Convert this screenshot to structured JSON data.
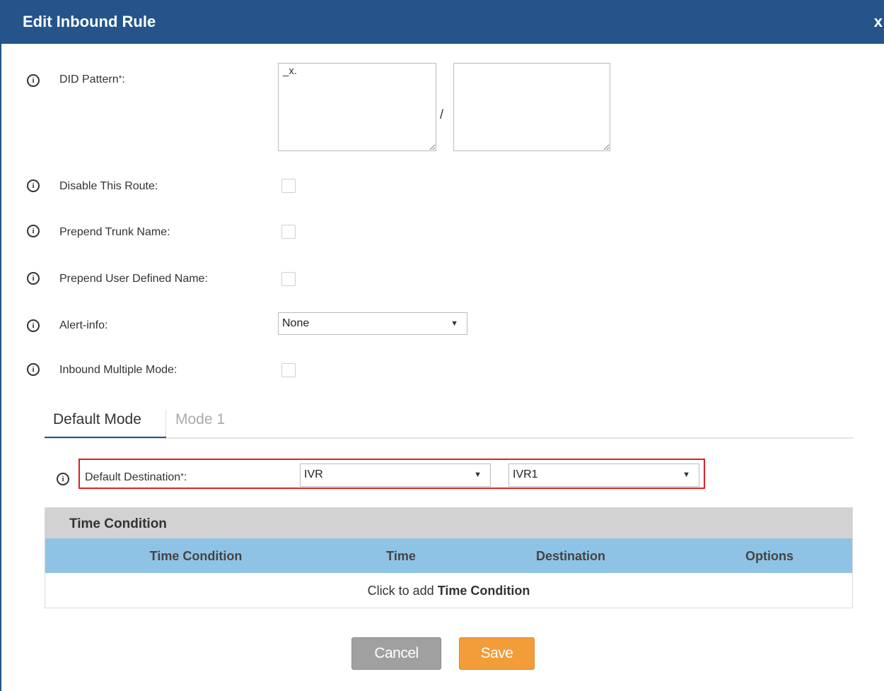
{
  "dialog": {
    "title": "Edit Inbound Rule",
    "close_label": "x"
  },
  "fields": {
    "did_pattern": {
      "label": "DID Pattern",
      "required": "*",
      "colon": ":",
      "value": "_x.",
      "value2": "",
      "separator": "/"
    },
    "disable_route": {
      "label": "Disable This Route:",
      "checked": false
    },
    "prepend_trunk": {
      "label": "Prepend Trunk Name:",
      "checked": false
    },
    "prepend_user": {
      "label": "Prepend User Defined Name:",
      "checked": false
    },
    "alert_info": {
      "label": "Alert-info:",
      "value": "None"
    },
    "inbound_multiple": {
      "label": "Inbound Multiple Mode:",
      "checked": false
    }
  },
  "tabs": [
    {
      "label": "Default Mode",
      "active": true
    },
    {
      "label": "Mode 1",
      "active": false
    }
  ],
  "default_destination": {
    "label": "Default Destination",
    "required": "*",
    "colon": ":",
    "type_value": "IVR",
    "target_value": "IVR1"
  },
  "time_condition": {
    "title": "Time Condition",
    "columns": [
      "Time Condition",
      "Time",
      "Destination",
      "Options"
    ],
    "empty_prefix": "Click to add ",
    "empty_link": "Time Condition"
  },
  "buttons": {
    "cancel": "Cancel",
    "save": "Save"
  },
  "colors": {
    "header": "#24548a",
    "table_header": "#8fc3e5",
    "save": "#f29c3a",
    "cancel": "#a0a0a0",
    "highlight": "#e02020"
  },
  "icons": {
    "info": "info-circle-icon",
    "caret": "caret-down-icon"
  }
}
